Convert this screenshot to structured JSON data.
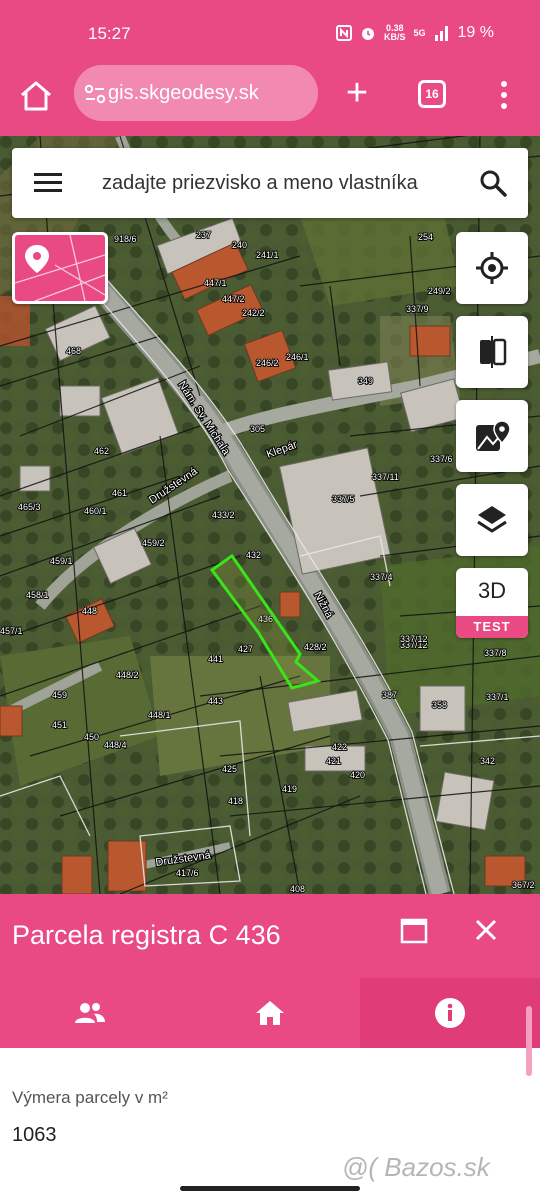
{
  "status_bar": {
    "time": "15:27",
    "speed_value": "0.38",
    "speed_unit": "KB/S",
    "network": "5G",
    "battery": "19 %"
  },
  "browser": {
    "url": "gis.skgeodesy.sk",
    "tab_count": "16"
  },
  "search": {
    "placeholder": "zadajte priezvisko a meno vlastníka"
  },
  "map_controls": {
    "three_d_label": "3D",
    "test_badge": "TEST"
  },
  "map_labels": {
    "streets": [
      "Nám. Sv. Michala",
      "Klepár",
      "Nižná",
      "Družstevná",
      "Družstevná"
    ],
    "parcels": [
      "918/6",
      "237",
      "240",
      "241/1",
      "254",
      "447/1",
      "447/2",
      "242/2",
      "249/2",
      "337/9",
      "468",
      "246/2",
      "246/1",
      "349",
      "337/6",
      "462",
      "305",
      "337/5",
      "337/11",
      "337/12",
      "465/3",
      "461",
      "460/1",
      "433/2",
      "337/4",
      "459/1",
      "459/2",
      "458/1",
      "432",
      "436",
      "428/2",
      "337/8",
      "457/1",
      "448",
      "441",
      "337/12",
      "337/1",
      "448/2",
      "427",
      "443",
      "358",
      "459",
      "451",
      "448/1",
      "450",
      "448/4",
      "422",
      "421",
      "420",
      "425",
      "418",
      "419",
      "417/6",
      "408",
      "342",
      "367/2",
      "387"
    ]
  },
  "parcel_panel": {
    "title": "Parcela registra C 436",
    "tabs": [
      {
        "icon": "people-icon"
      },
      {
        "icon": "house-icon"
      },
      {
        "icon": "info-icon",
        "active": true
      }
    ],
    "area_label": "Výmera parcely v m²",
    "area_value": "1063"
  },
  "watermark": "@( Bazos.sk",
  "colors": {
    "primary": "#e94a83",
    "parcel_highlight": "#39e51a"
  }
}
